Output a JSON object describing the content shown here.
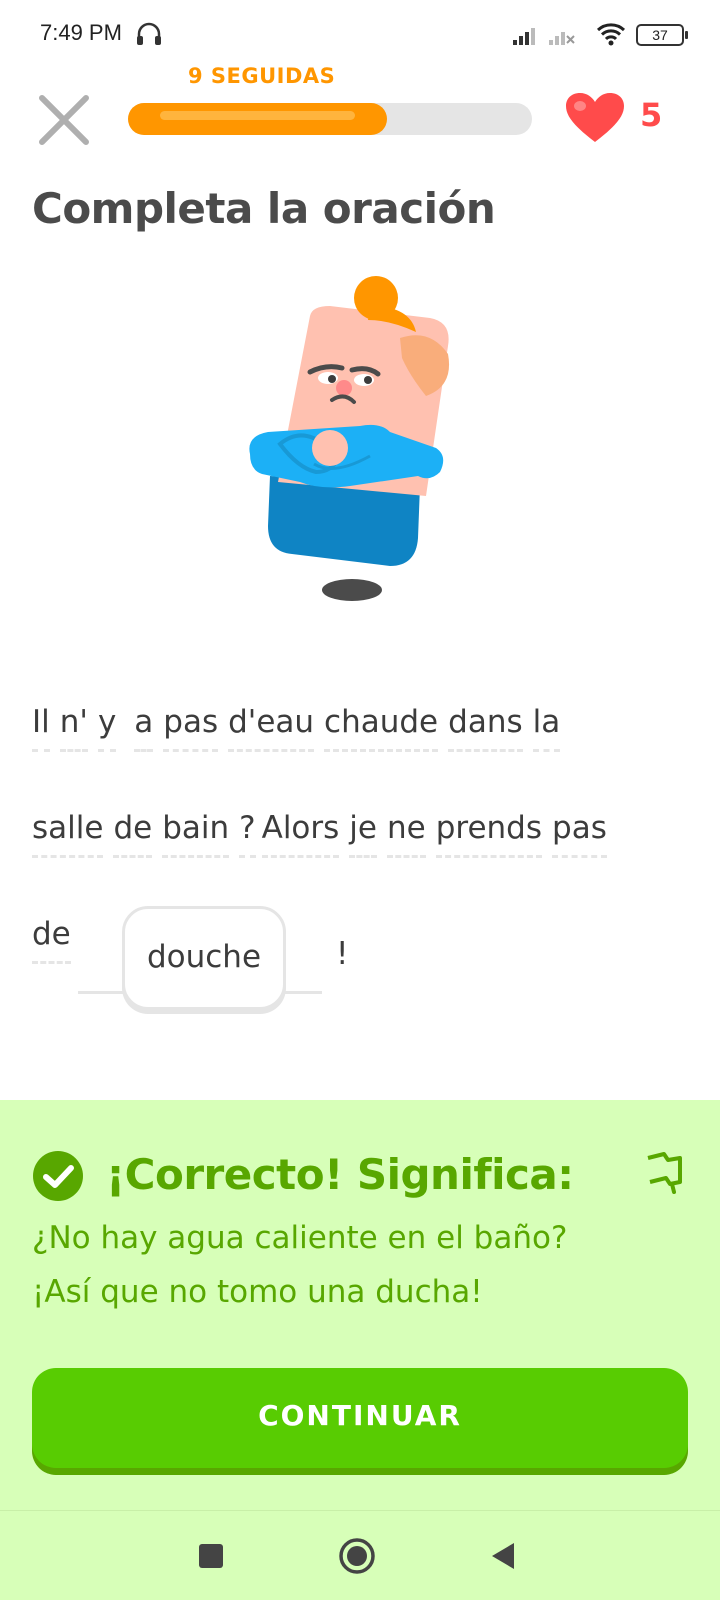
{
  "status_bar": {
    "time": "7:49 PM",
    "battery": "37",
    "icons": [
      "headset-icon",
      "signal-icon",
      "wifi-icon",
      "battery-icon"
    ]
  },
  "header": {
    "streak_label": "9 SEGUIDAS",
    "progress": 0.64,
    "hearts": "5",
    "icons": [
      "close-icon",
      "heart-icon"
    ]
  },
  "exercise": {
    "title": "Completa la oración",
    "line1": [
      "Il",
      "n'",
      "y",
      "a",
      "pas",
      "d'eau",
      "chaude",
      "dans",
      "la"
    ],
    "line2": [
      "salle",
      "de",
      "bain",
      "?",
      "Alors",
      "je",
      "ne",
      "prends",
      "pas"
    ],
    "line3_word": "de",
    "answer_chip": "douche",
    "end_punct": "!"
  },
  "feedback": {
    "title": "¡Correcto! Significa:",
    "translation_line1": "¿No hay agua caliente en el baño?",
    "translation_line2": "¡Así que no tomo una ducha!",
    "continue_label": "CONTINUAR",
    "colors": {
      "panel": "#d7ffb8",
      "text": "#58a700",
      "button": "#58cc02"
    }
  },
  "nav_bar": {
    "icons": [
      "recents-square-icon",
      "home-circle-icon",
      "back-triangle-icon"
    ]
  }
}
